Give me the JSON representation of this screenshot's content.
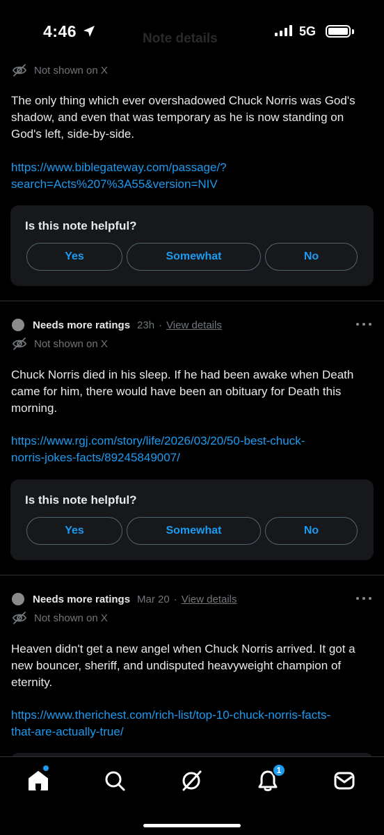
{
  "status_bar": {
    "time": "4:46",
    "network": "5G",
    "ghost_title": "Note details"
  },
  "notes": [
    {
      "not_shown": "Not shown on X",
      "text": "The only thing which ever overshadowed Chuck Norris was God's shadow, and even that was temporary as he is now standing on God's left, side-by-side.",
      "link_line1": "https://www.biblegateway.com/passage/?",
      "link_line2": "search=Acts%207%3A55&version=NIV",
      "helpful": {
        "question": "Is this note helpful?",
        "yes": "Yes",
        "somewhat": "Somewhat",
        "no": "No"
      }
    },
    {
      "status": "Needs more ratings",
      "time": "23h",
      "separator": "·",
      "view_details": "View details",
      "not_shown": "Not shown on X",
      "text": "Chuck Norris died in his sleep.  If he had been awake when Death came for him, there would have been an obituary for Death this morning.",
      "link_line1": "https://www.rgj.com/story/life/2026/03/20/50-best-chuck-",
      "link_line2": "norris-jokes-facts/89245849007/",
      "helpful": {
        "question": "Is this note helpful?",
        "yes": "Yes",
        "somewhat": "Somewhat",
        "no": "No"
      }
    },
    {
      "status": "Needs more ratings",
      "time": "Mar 20",
      "separator": "·",
      "view_details": "View details",
      "not_shown": "Not shown on X",
      "text": "Heaven didn't get a new angel when Chuck Norris arrived. It got a new bouncer, sheriff, and undisputed heavyweight champion of eternity.",
      "link_line1": "https://www.therichest.com/rich-list/top-10-chuck-norris-facts-",
      "link_line2": "that-are-actually-true/"
    }
  ],
  "bottom_nav": {
    "items": [
      "home-icon",
      "search-icon",
      "grok-icon",
      "notifications-icon",
      "messages-icon"
    ],
    "notification_count": "1"
  },
  "colors": {
    "accent": "#1d9bf0",
    "muted": "#71767b",
    "card": "#16181c",
    "divider": "#2f3336"
  }
}
